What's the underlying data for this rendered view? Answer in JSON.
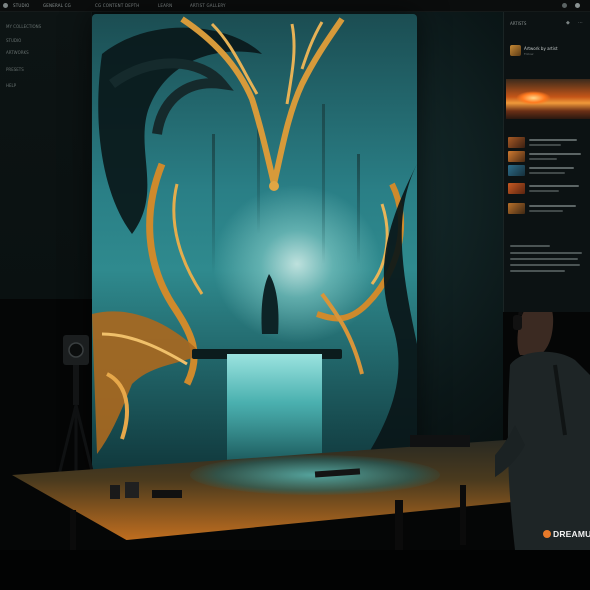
{
  "topbar": {
    "items": [
      "STUDIO",
      "GENERAL CG",
      "CG CONTENT DEPTH",
      "LEARN",
      "ARTIST GALLERY"
    ]
  },
  "left_panel": {
    "labels": [
      "MY COLLECTIONS",
      "STUDIO",
      "ARTWORKS",
      "PRESETS",
      "HELP"
    ]
  },
  "right_panel": {
    "title": "ARTISTS",
    "artist_name": "Artwork by artist",
    "artist_sub": "Follow"
  },
  "brand": {
    "name": "DREAMU",
    "accent": "#e77a2a"
  },
  "colors": {
    "teal": "#2a7f86",
    "gold": "#d79a3a",
    "dark": "#050606"
  }
}
